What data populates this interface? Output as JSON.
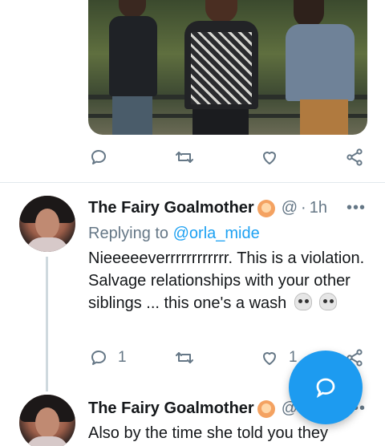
{
  "media": {
    "alt": "Three men laughing outdoors"
  },
  "action_bar_top": {
    "reply_count": "",
    "retweet_count": "",
    "like_count": ""
  },
  "tweet_1": {
    "author_name": "The Fairy Goalmother",
    "handle": "@",
    "separator": "·",
    "time": "1h",
    "more_label": "•••",
    "replying_label": "Replying to",
    "replying_mention": "@orla_mide",
    "text": "Nieeeeeverrrrrrrrrrrr. This is a violation. Salvage relationships with your other siblings ... this one's a wash",
    "reply_count": "1",
    "retweet_count": "",
    "like_count": "1"
  },
  "tweet_2": {
    "author_name": "The Fairy Goalmother",
    "handle": "@",
    "more_label": "•••",
    "text": "Also by the time she told you they"
  },
  "colors": {
    "accent": "#1d9bf0",
    "muted": "#657786",
    "text": "#14171a",
    "divider": "#e1e8ed"
  },
  "icons": {
    "reply": "reply-icon",
    "retweet": "retweet-icon",
    "like": "heart-icon",
    "share": "share-icon",
    "compose": "compose-reply-icon"
  }
}
